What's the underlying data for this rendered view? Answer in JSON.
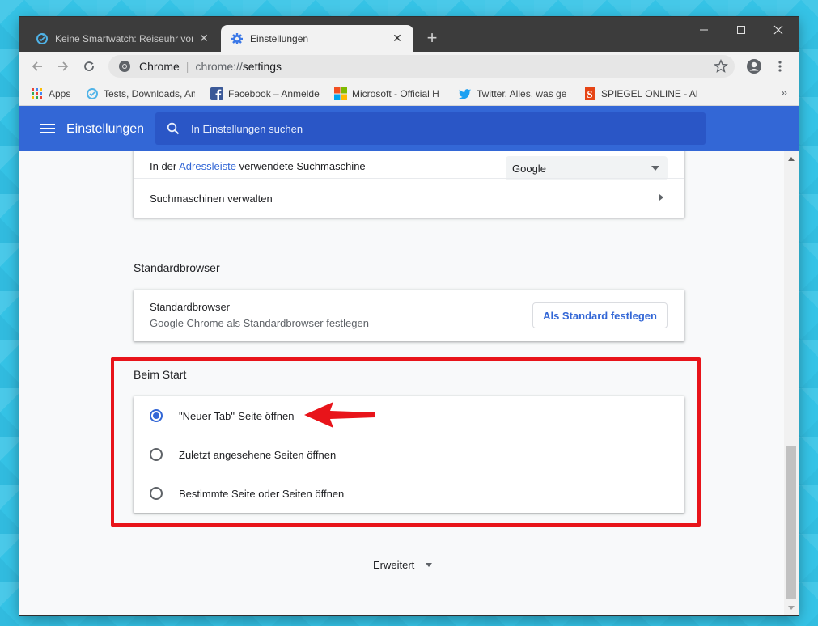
{
  "tabs": [
    {
      "title": "Keine Smartwatch: Reiseuhr von (",
      "icon": "refresh-circle-icon",
      "active": false
    },
    {
      "title": "Einstellungen",
      "icon": "gear-icon",
      "active": true
    }
  ],
  "address_bar": {
    "site_name": "Chrome",
    "url_scheme": "chrome://",
    "url_path": "settings"
  },
  "bookmarks": [
    {
      "label": "Apps",
      "icon": "apps-grid-icon"
    },
    {
      "label": "Tests, Downloads, An",
      "icon": "refresh-circle-icon"
    },
    {
      "label": "Facebook – Anmelde",
      "icon": "facebook-icon"
    },
    {
      "label": "Microsoft - Official H",
      "icon": "microsoft-icon"
    },
    {
      "label": "Twitter. Alles, was ge",
      "icon": "twitter-icon"
    },
    {
      "label": "SPIEGEL ONLINE - Ak",
      "icon": "spiegel-icon"
    }
  ],
  "bookmarks_more": "»",
  "header": {
    "title": "Einstellungen",
    "search_placeholder": "In Einstellungen suchen"
  },
  "search_engine": {
    "label_prefix": "In der ",
    "label_link": "Adressleiste",
    "label_suffix": " verwendete Suchmaschine",
    "selected": "Google",
    "manage_label": "Suchmaschinen verwalten"
  },
  "default_browser": {
    "section_title": "Standardbrowser",
    "row_title": "Standardbrowser",
    "row_subtitle": "Google Chrome als Standardbrowser festlegen",
    "button_label": "Als Standard festlegen"
  },
  "on_startup": {
    "section_title": "Beim Start",
    "options": [
      {
        "label": "\"Neuer Tab\"-Seite öffnen",
        "selected": true
      },
      {
        "label": "Zuletzt angesehene Seiten öffnen",
        "selected": false
      },
      {
        "label": "Bestimmte Seite oder Seiten öffnen",
        "selected": false
      }
    ]
  },
  "advanced_label": "Erweitert",
  "colors": {
    "accent": "#3367d6",
    "highlight": "#e8141a",
    "titlebar": "#3c3c3c"
  }
}
